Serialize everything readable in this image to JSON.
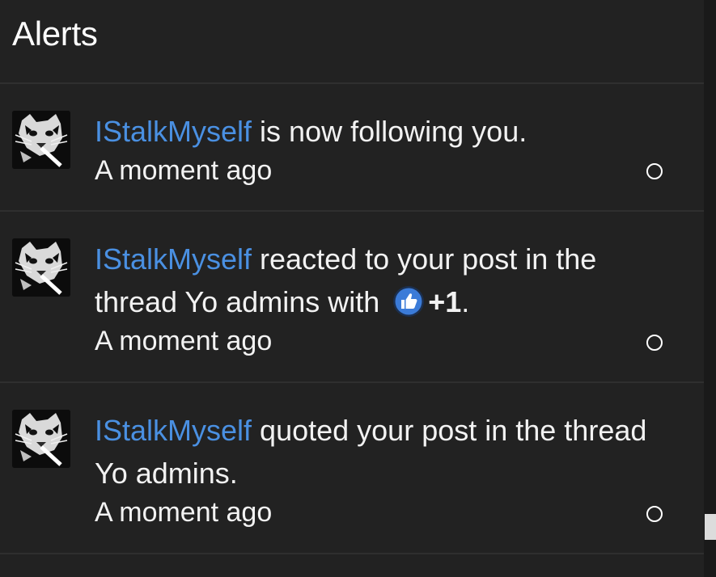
{
  "header": {
    "title": "Alerts"
  },
  "alerts": [
    {
      "user": "IStalkMyself",
      "text": " is now following you.",
      "time": "A moment ago"
    },
    {
      "user": "IStalkMyself",
      "text_before": " reacted to your post in the thread Yo admins with ",
      "reaction_icon": "thumbs-up-icon",
      "reaction_name": "+1",
      "text_after": ".",
      "time": "A moment ago"
    },
    {
      "user": "IStalkMyself",
      "text": " quoted your post in the thread Yo admins.",
      "time": "A moment ago"
    }
  ],
  "colors": {
    "username": "#4a90e2",
    "background": "#222222",
    "text": "#f2f2f2",
    "reaction_blue": "#3b7bd8"
  }
}
